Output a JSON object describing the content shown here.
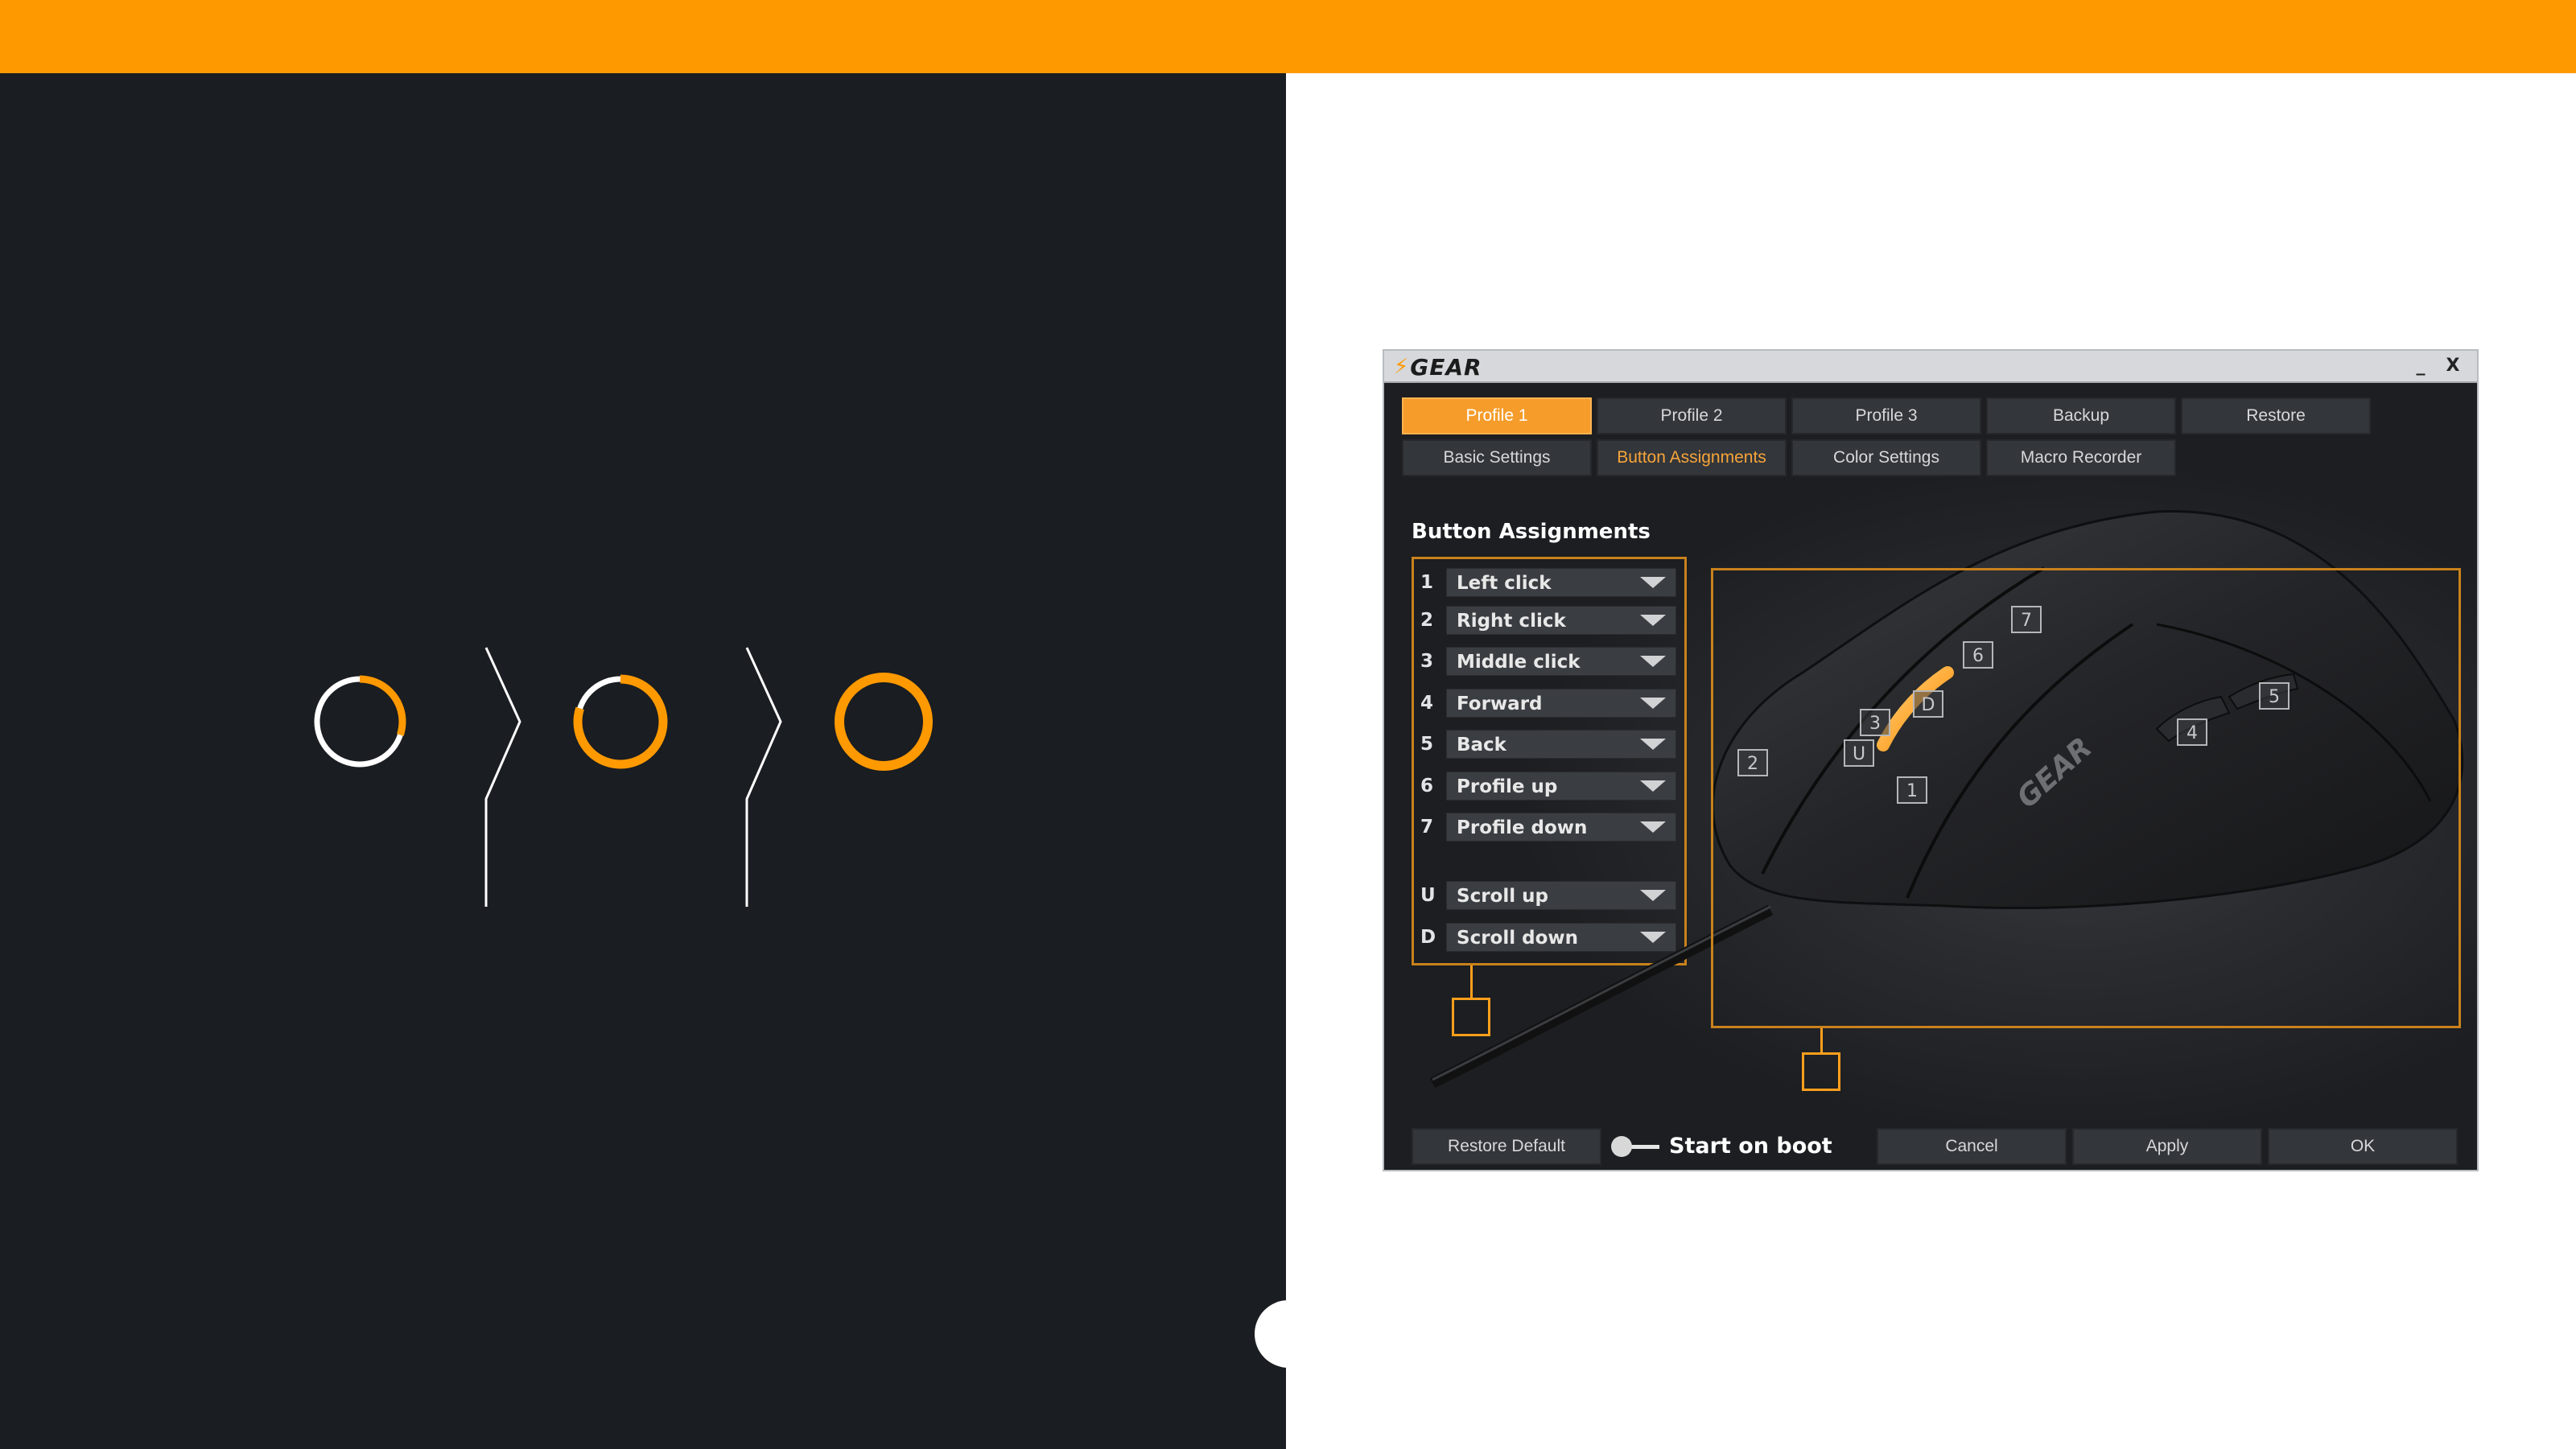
{
  "colors": {
    "accent": "#ff9900",
    "dark_bg": "#1a1d21",
    "panel_bg": "#ffffff",
    "window_bg": "#1d1f22",
    "tab_bg": "#33363a",
    "tab_active": "#f59c2a",
    "border_accent": "#c9821c"
  },
  "progress_steps": [
    {
      "name": "step-1-progress-ring",
      "fill": 0.3
    },
    {
      "name": "step-2-progress-ring",
      "fill": 0.8
    },
    {
      "name": "step-3-progress-ring",
      "fill": 1.0
    }
  ],
  "window": {
    "logo_text": "GEAR",
    "minimize_label": "_",
    "close_label": "X"
  },
  "tabs": {
    "profiles": [
      "Profile 1",
      "Profile 2",
      "Profile 3",
      "Backup",
      "Restore"
    ],
    "active_profile": "Profile 1",
    "settings": [
      "Basic Settings",
      "Button Assignments",
      "Color Settings",
      "Macro Recorder"
    ],
    "active_setting": "Button Assignments"
  },
  "section_title": "Button Assignments",
  "assignments": [
    {
      "key": "1",
      "action": "Left click"
    },
    {
      "key": "2",
      "action": "Right click"
    },
    {
      "key": "3",
      "action": "Middle click"
    },
    {
      "key": "4",
      "action": "Forward"
    },
    {
      "key": "5",
      "action": "Back"
    },
    {
      "key": "6",
      "action": "Profile up"
    },
    {
      "key": "7",
      "action": "Profile down"
    },
    {
      "key": "U",
      "action": "Scroll up"
    },
    {
      "key": "D",
      "action": "Scroll down"
    }
  ],
  "mouse": {
    "brand_text": "GEAR",
    "markers": [
      "7",
      "6",
      "D",
      "3",
      "U",
      "2",
      "1",
      "4",
      "5"
    ]
  },
  "footer": {
    "restore_default": "Restore Default",
    "start_on_boot": "Start on boot",
    "cancel": "Cancel",
    "apply": "Apply",
    "ok": "OK"
  }
}
